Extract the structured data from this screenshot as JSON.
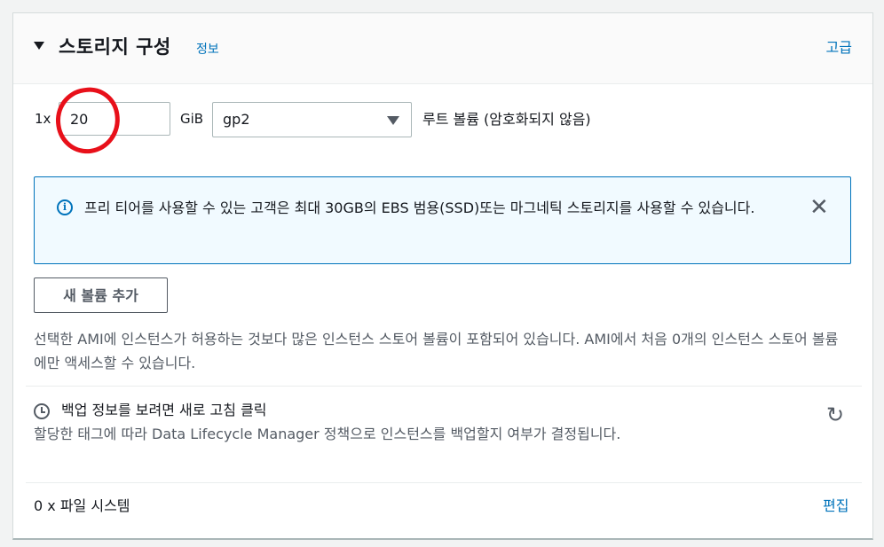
{
  "header": {
    "title": "스토리지 구성",
    "info_link": "정보",
    "advanced_link": "고급"
  },
  "volume": {
    "multiplier": "1x",
    "size_value": "20",
    "unit": "GiB",
    "type_value": "gp2",
    "root_label": "루트 볼륨  (암호화되지 않음)"
  },
  "alert": {
    "message": "프리 티어를 사용할 수 있는 고객은 최대 30GB의 EBS 범용(SSD)또는 마그네틱 스토리지를 사용할 수 있습니다.",
    "close_icon": "close-icon"
  },
  "add_volume_button": "새 볼륨 추가",
  "ami_note": "선택한 AMI에 인스턴스가 허용하는 것보다 많은 인스턴스 스토어 볼륨이 포함되어 있습니다. AMI에서 처음 0개의 인스턴스 스토어 볼륨에만 액세스할 수 있습니다.",
  "backup": {
    "title": "백업 정보를 보려면 새로 고침 클릭",
    "description": "할당한 태그에 따라 Data Lifecycle Manager 정책으로 인스턴스를 백업할지 여부가 결정됩니다.",
    "clock_icon": "clock-icon",
    "refresh_icon": "refresh-icon"
  },
  "file_systems": {
    "label": "0 x 파일 시스템",
    "edit_link": "편집"
  },
  "colors": {
    "link": "#0073bb",
    "annotation": "#e8101a",
    "alert_bg": "#f1faff"
  }
}
